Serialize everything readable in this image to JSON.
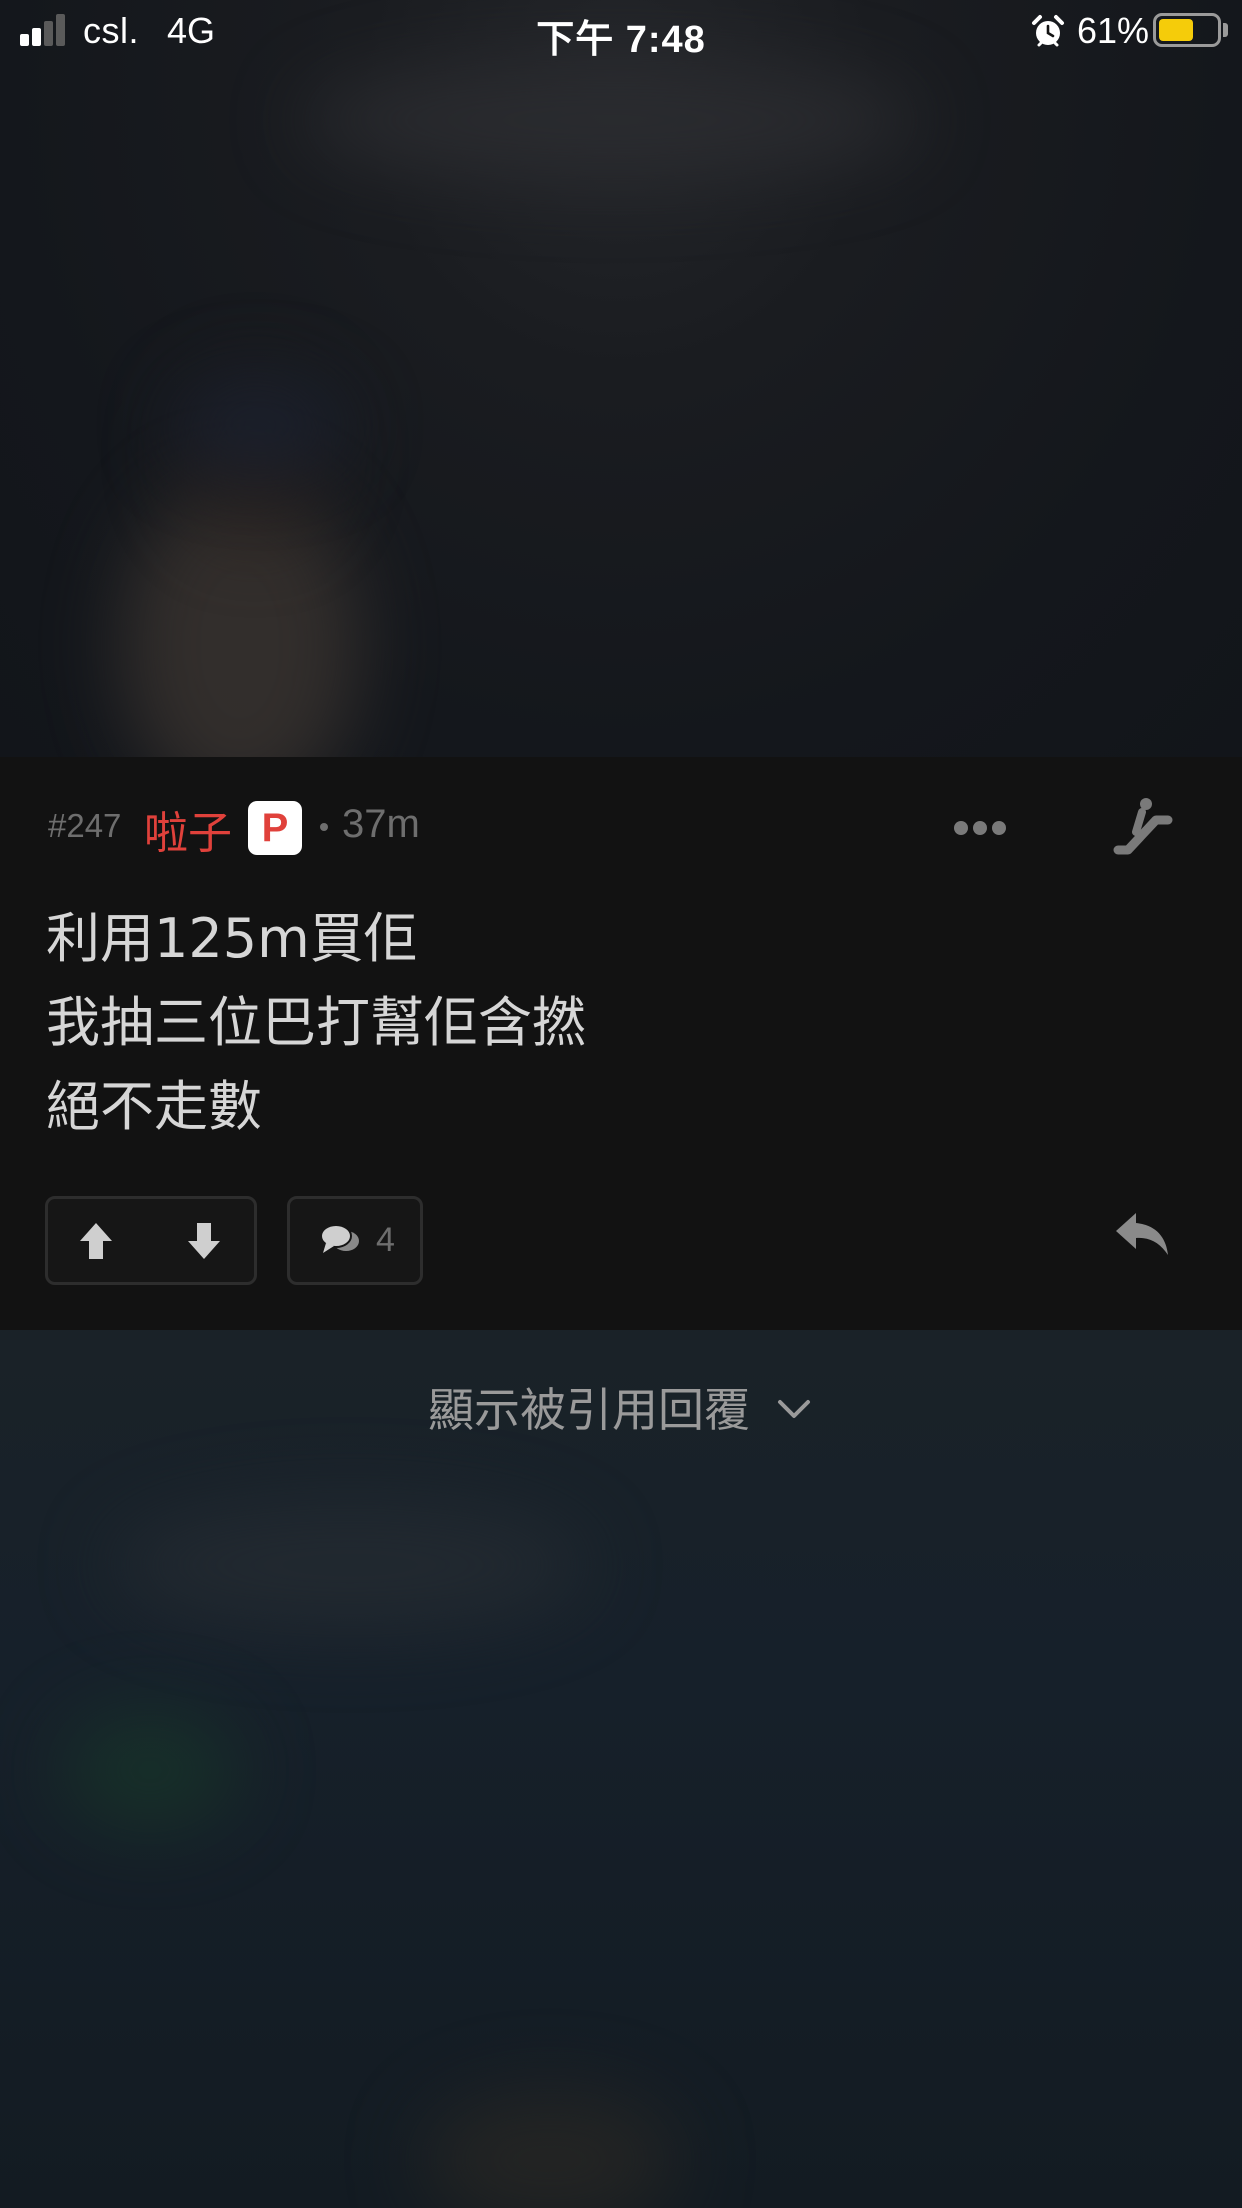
{
  "status_bar": {
    "carrier": "csl.",
    "network": "4G",
    "time": "下午 7:48",
    "battery_percent_text": "61%",
    "battery_level": 0.61,
    "battery_color": "#f5cc0a",
    "icons": [
      "signal-icon",
      "alarm-icon",
      "battery-icon"
    ]
  },
  "post": {
    "number": "#247",
    "username": "啦子",
    "username_color": "#e0413b",
    "badge": "P",
    "time_ago": "37m",
    "body_lines": [
      "利用125m買佢",
      "我抽三位巴打幫佢含撚",
      "絕不走數"
    ],
    "comment_count": "4",
    "icons": [
      "more-icon",
      "escalator-icon",
      "upvote-icon",
      "downvote-icon",
      "comment-icon",
      "reply-icon"
    ]
  },
  "show_quoted": {
    "label": "顯示被引用回覆"
  }
}
